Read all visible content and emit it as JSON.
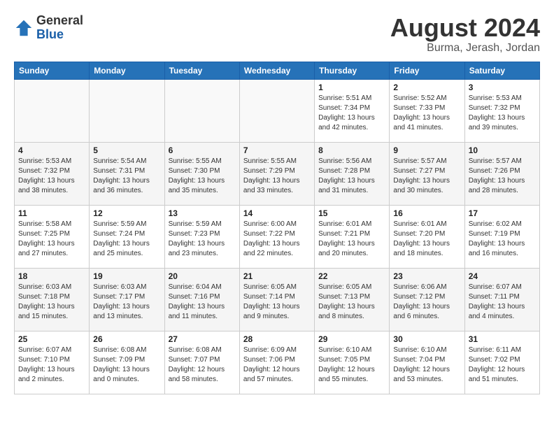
{
  "logo": {
    "general": "General",
    "blue": "Blue"
  },
  "title": "August 2024",
  "location": "Burma, Jerash, Jordan",
  "days_of_week": [
    "Sunday",
    "Monday",
    "Tuesday",
    "Wednesday",
    "Thursday",
    "Friday",
    "Saturday"
  ],
  "weeks": [
    [
      {
        "day": "",
        "info": ""
      },
      {
        "day": "",
        "info": ""
      },
      {
        "day": "",
        "info": ""
      },
      {
        "day": "",
        "info": ""
      },
      {
        "day": "1",
        "info": "Sunrise: 5:51 AM\nSunset: 7:34 PM\nDaylight: 13 hours\nand 42 minutes."
      },
      {
        "day": "2",
        "info": "Sunrise: 5:52 AM\nSunset: 7:33 PM\nDaylight: 13 hours\nand 41 minutes."
      },
      {
        "day": "3",
        "info": "Sunrise: 5:53 AM\nSunset: 7:32 PM\nDaylight: 13 hours\nand 39 minutes."
      }
    ],
    [
      {
        "day": "4",
        "info": "Sunrise: 5:53 AM\nSunset: 7:32 PM\nDaylight: 13 hours\nand 38 minutes."
      },
      {
        "day": "5",
        "info": "Sunrise: 5:54 AM\nSunset: 7:31 PM\nDaylight: 13 hours\nand 36 minutes."
      },
      {
        "day": "6",
        "info": "Sunrise: 5:55 AM\nSunset: 7:30 PM\nDaylight: 13 hours\nand 35 minutes."
      },
      {
        "day": "7",
        "info": "Sunrise: 5:55 AM\nSunset: 7:29 PM\nDaylight: 13 hours\nand 33 minutes."
      },
      {
        "day": "8",
        "info": "Sunrise: 5:56 AM\nSunset: 7:28 PM\nDaylight: 13 hours\nand 31 minutes."
      },
      {
        "day": "9",
        "info": "Sunrise: 5:57 AM\nSunset: 7:27 PM\nDaylight: 13 hours\nand 30 minutes."
      },
      {
        "day": "10",
        "info": "Sunrise: 5:57 AM\nSunset: 7:26 PM\nDaylight: 13 hours\nand 28 minutes."
      }
    ],
    [
      {
        "day": "11",
        "info": "Sunrise: 5:58 AM\nSunset: 7:25 PM\nDaylight: 13 hours\nand 27 minutes."
      },
      {
        "day": "12",
        "info": "Sunrise: 5:59 AM\nSunset: 7:24 PM\nDaylight: 13 hours\nand 25 minutes."
      },
      {
        "day": "13",
        "info": "Sunrise: 5:59 AM\nSunset: 7:23 PM\nDaylight: 13 hours\nand 23 minutes."
      },
      {
        "day": "14",
        "info": "Sunrise: 6:00 AM\nSunset: 7:22 PM\nDaylight: 13 hours\nand 22 minutes."
      },
      {
        "day": "15",
        "info": "Sunrise: 6:01 AM\nSunset: 7:21 PM\nDaylight: 13 hours\nand 20 minutes."
      },
      {
        "day": "16",
        "info": "Sunrise: 6:01 AM\nSunset: 7:20 PM\nDaylight: 13 hours\nand 18 minutes."
      },
      {
        "day": "17",
        "info": "Sunrise: 6:02 AM\nSunset: 7:19 PM\nDaylight: 13 hours\nand 16 minutes."
      }
    ],
    [
      {
        "day": "18",
        "info": "Sunrise: 6:03 AM\nSunset: 7:18 PM\nDaylight: 13 hours\nand 15 minutes."
      },
      {
        "day": "19",
        "info": "Sunrise: 6:03 AM\nSunset: 7:17 PM\nDaylight: 13 hours\nand 13 minutes."
      },
      {
        "day": "20",
        "info": "Sunrise: 6:04 AM\nSunset: 7:16 PM\nDaylight: 13 hours\nand 11 minutes."
      },
      {
        "day": "21",
        "info": "Sunrise: 6:05 AM\nSunset: 7:14 PM\nDaylight: 13 hours\nand 9 minutes."
      },
      {
        "day": "22",
        "info": "Sunrise: 6:05 AM\nSunset: 7:13 PM\nDaylight: 13 hours\nand 8 minutes."
      },
      {
        "day": "23",
        "info": "Sunrise: 6:06 AM\nSunset: 7:12 PM\nDaylight: 13 hours\nand 6 minutes."
      },
      {
        "day": "24",
        "info": "Sunrise: 6:07 AM\nSunset: 7:11 PM\nDaylight: 13 hours\nand 4 minutes."
      }
    ],
    [
      {
        "day": "25",
        "info": "Sunrise: 6:07 AM\nSunset: 7:10 PM\nDaylight: 13 hours\nand 2 minutes."
      },
      {
        "day": "26",
        "info": "Sunrise: 6:08 AM\nSunset: 7:09 PM\nDaylight: 13 hours\nand 0 minutes."
      },
      {
        "day": "27",
        "info": "Sunrise: 6:08 AM\nSunset: 7:07 PM\nDaylight: 12 hours\nand 58 minutes."
      },
      {
        "day": "28",
        "info": "Sunrise: 6:09 AM\nSunset: 7:06 PM\nDaylight: 12 hours\nand 57 minutes."
      },
      {
        "day": "29",
        "info": "Sunrise: 6:10 AM\nSunset: 7:05 PM\nDaylight: 12 hours\nand 55 minutes."
      },
      {
        "day": "30",
        "info": "Sunrise: 6:10 AM\nSunset: 7:04 PM\nDaylight: 12 hours\nand 53 minutes."
      },
      {
        "day": "31",
        "info": "Sunrise: 6:11 AM\nSunset: 7:02 PM\nDaylight: 12 hours\nand 51 minutes."
      }
    ]
  ]
}
